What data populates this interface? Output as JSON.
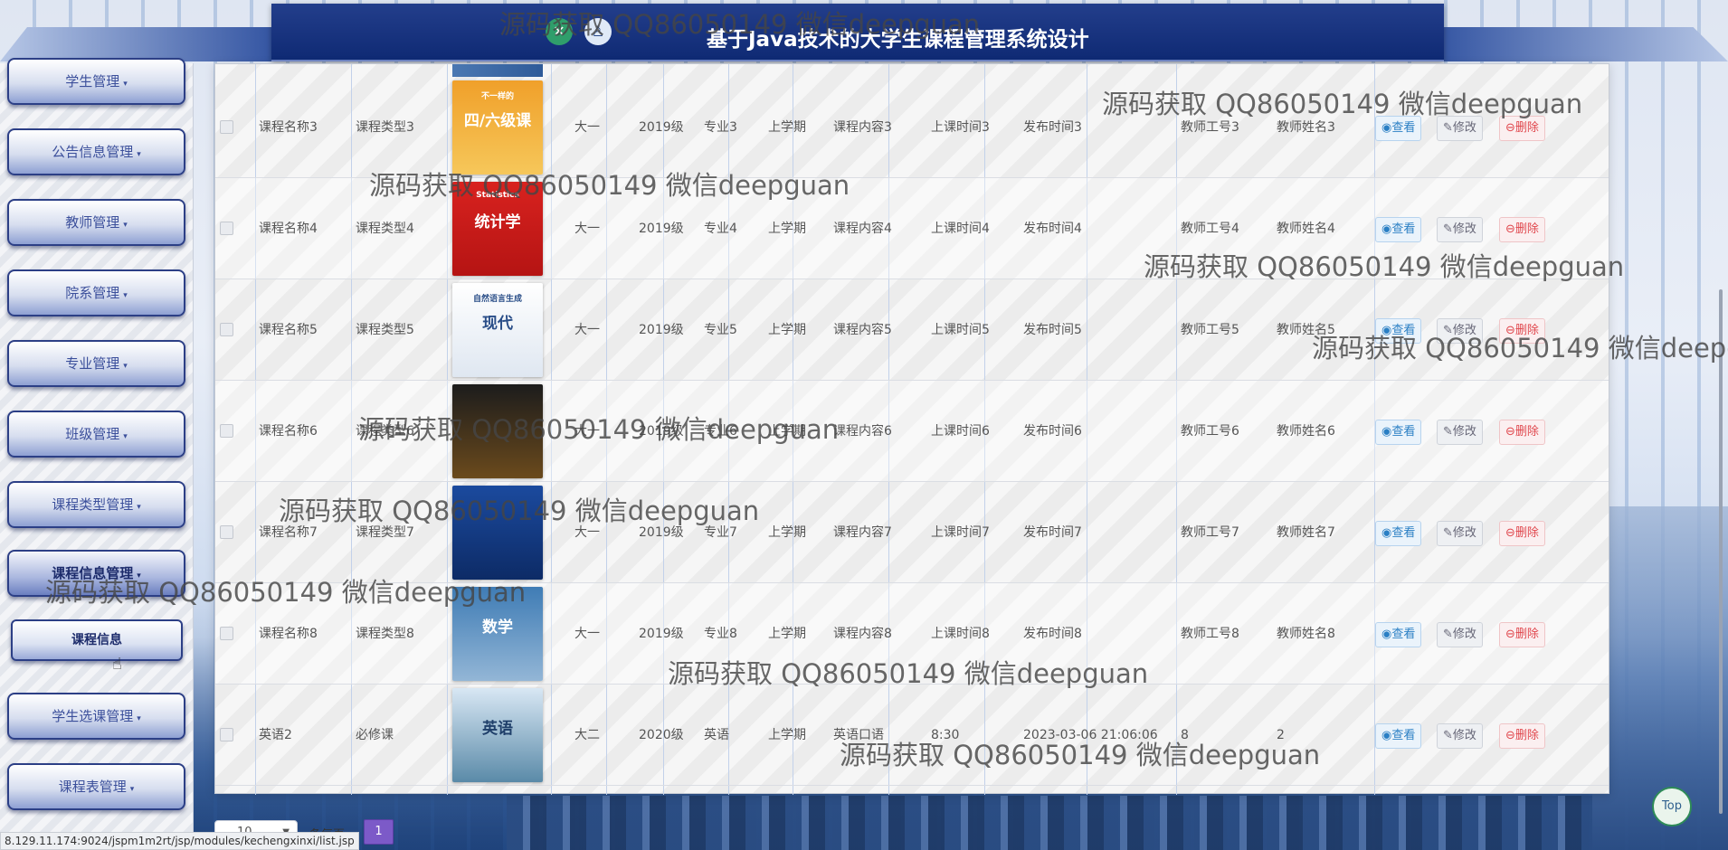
{
  "header": {
    "title": "基于Java技术的大学生课程管理系统设计",
    "icons": [
      "settings-icon",
      "user-icon"
    ]
  },
  "sidebar": {
    "items": [
      {
        "label": "学生管理"
      },
      {
        "label": "公告信息管理"
      },
      {
        "label": "教师管理"
      },
      {
        "label": "院系管理"
      },
      {
        "label": "专业管理"
      },
      {
        "label": "班级管理"
      },
      {
        "label": "课程类型管理"
      },
      {
        "label": "课程信息管理"
      },
      {
        "label": "学生选课管理"
      },
      {
        "label": "课程表管理"
      }
    ],
    "submenu": {
      "label": "课程信息"
    },
    "caret": "▾"
  },
  "table": {
    "rows": [
      {
        "name": "课程名称3",
        "type": "课程类型3",
        "grade": "大一",
        "year": "2019级",
        "major": "专业3",
        "term": "上学期",
        "content": "课程内容3",
        "time": "上课时间3",
        "publish": "发布时间3",
        "tid": "教师工号3",
        "tname": "教师姓名3",
        "cover_title": "四/六级课",
        "cover_sub": "不一样的"
      },
      {
        "name": "课程名称4",
        "type": "课程类型4",
        "grade": "大一",
        "year": "2019级",
        "major": "专业4",
        "term": "上学期",
        "content": "课程内容4",
        "time": "上课时间4",
        "publish": "发布时间4",
        "tid": "教师工号4",
        "tname": "教师姓名4",
        "cover_title": "统计学",
        "cover_sub": "Statistics"
      },
      {
        "name": "课程名称5",
        "type": "课程类型5",
        "grade": "大一",
        "year": "2019级",
        "major": "专业5",
        "term": "上学期",
        "content": "课程内容5",
        "time": "上课时间5",
        "publish": "发布时间5",
        "tid": "教师工号5",
        "tname": "教师姓名5",
        "cover_title": "现代",
        "cover_sub": "自然语言生成"
      },
      {
        "name": "课程名称6",
        "type": "课程类型6",
        "grade": "大一",
        "year": "2019级",
        "major": "专业6",
        "term": "上学期",
        "content": "课程内容6",
        "time": "上课时间6",
        "publish": "发布时间6",
        "tid": "教师工号6",
        "tname": "教师姓名6",
        "cover_title": "",
        "cover_sub": ""
      },
      {
        "name": "课程名称7",
        "type": "课程类型7",
        "grade": "大一",
        "year": "2019级",
        "major": "专业7",
        "term": "上学期",
        "content": "课程内容7",
        "time": "上课时间7",
        "publish": "发布时间7",
        "tid": "教师工号7",
        "tname": "教师姓名7",
        "cover_title": "",
        "cover_sub": ""
      },
      {
        "name": "课程名称8",
        "type": "课程类型8",
        "grade": "大一",
        "year": "2019级",
        "major": "专业8",
        "term": "上学期",
        "content": "课程内容8",
        "time": "上课时间8",
        "publish": "发布时间8",
        "tid": "教师工号8",
        "tname": "教师姓名8",
        "cover_title": "数学",
        "cover_sub": ""
      },
      {
        "name": "英语2",
        "type": "必修课",
        "grade": "大二",
        "year": "2020级",
        "major": "英语",
        "term": "上学期",
        "content": "英语口语",
        "time": "8:30",
        "publish": "2023-03-06 21:06:06",
        "tid": "8",
        "tname": "2",
        "cover_title": "英语",
        "cover_sub": ""
      }
    ],
    "actions": {
      "view": "◉查看",
      "edit": "✎修改",
      "delete": "⊖删除"
    }
  },
  "pagination": {
    "page_size": "10",
    "per_page_label": "条每页",
    "current_page": "1"
  },
  "top_button": "Top",
  "status_url": "8.129.11.174:9024/jspm1m2rt/jsp/modules/kechengxinxi/list.jsp",
  "watermark": "源码获取 QQ86050149 微信deepguan",
  "colors": {
    "header": "#0f2a74",
    "accent": "#7c5ac8",
    "delete": "#e0464c",
    "view": "#2a7fc4"
  }
}
